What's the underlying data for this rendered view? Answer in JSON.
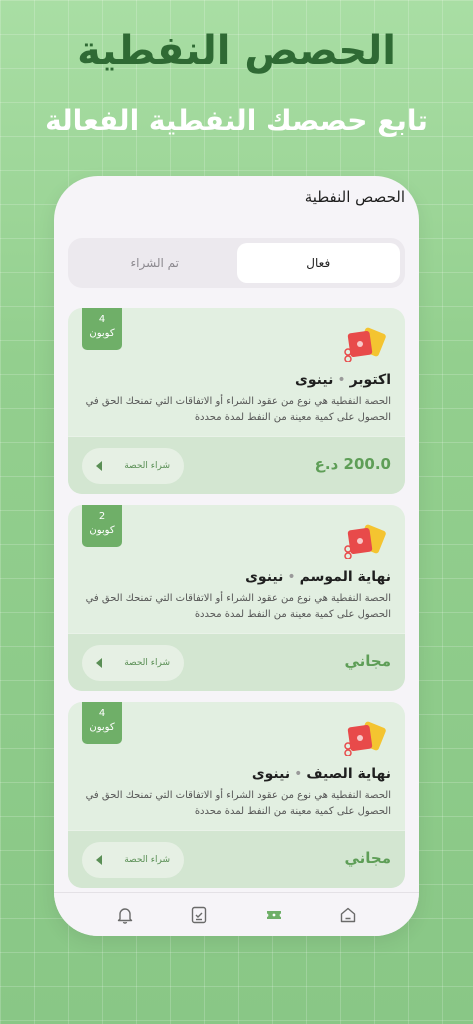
{
  "hero": {
    "title": "الحصص النفطية",
    "subtitle": "تابع حصصك النفطية الفعالة"
  },
  "screen": {
    "title": "الحصص النفطية"
  },
  "tabs": [
    {
      "label": "فعال",
      "active": true
    },
    {
      "label": "تم الشراء",
      "active": false
    }
  ],
  "cards": [
    {
      "badge_count": "4",
      "badge_label": "كوبون",
      "period": "اكتوبر",
      "location": "نينوى",
      "description": "الحصة النفطية هي نوع من عقود الشراء أو الاتفاقات التي تمنحك الحق في الحصول على كمية معينة من النفط لمدة محددة",
      "price": "200.0 د.ع",
      "button_label": "شراء الحصة",
      "icon": "ticket-coupon-icon"
    },
    {
      "badge_count": "2",
      "badge_label": "كوبون",
      "period": "نهاية الموسم",
      "location": "نينوى",
      "description": "الحصة النفطية هي نوع من عقود الشراء أو الاتفاقات التي تمنحك الحق في الحصول على كمية معينة من النفط لمدة محددة",
      "price": "مجاني",
      "button_label": "شراء الحصة",
      "icon": "ticket-coupon-icon"
    },
    {
      "badge_count": "4",
      "badge_label": "كوبون",
      "period": "نهاية الصيف",
      "location": "نينوى",
      "description": "الحصة النفطية هي نوع من عقود الشراء أو الاتفاقات التي تمنحك الحق في الحصول على كمية معينة من النفط لمدة محددة",
      "price": "مجاني",
      "button_label": "شراء الحصة",
      "icon": "ticket-coupon-icon"
    }
  ],
  "nav": [
    {
      "icon": "bell-icon",
      "active": false
    },
    {
      "icon": "checklist-icon",
      "active": false
    },
    {
      "icon": "ticket-icon",
      "active": true
    },
    {
      "icon": "home-icon",
      "active": false
    }
  ],
  "colors": {
    "accent": "#6faf68",
    "price": "#5e9e57",
    "card_bg": "#e2efe1",
    "hero_title": "#2f6a34"
  }
}
